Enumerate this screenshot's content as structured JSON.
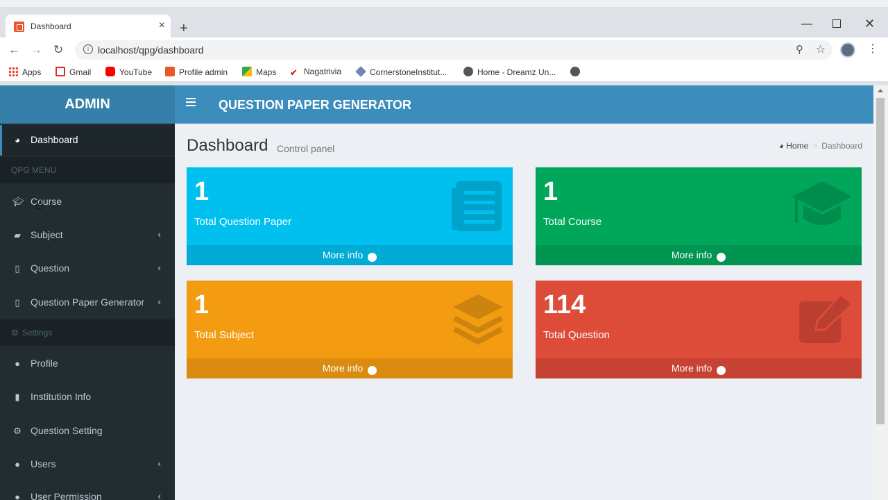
{
  "browser": {
    "tab_title": "Dashboard",
    "url": "localhost/qpg/dashboard",
    "bookmarks": [
      "Apps",
      "Gmail",
      "YouTube",
      "Profile admin",
      "Maps",
      "Nagatrivia",
      "CornerstoneInstitut...",
      "Home - Dreamz Un..."
    ]
  },
  "sidebar": {
    "logo": "ADMIN",
    "dashboard": "Dashboard",
    "section_qpg": "QPG MENU",
    "course": "Course",
    "subject": "Subject",
    "question": "Question",
    "qpg": "Question Paper Generator",
    "section_settings": "Settings",
    "profile": "Profile",
    "institution": "Institution Info",
    "question_setting": "Question Setting",
    "users": "Users",
    "user_permission": "User Permission"
  },
  "header": {
    "title": "QUESTION PAPER GENERATOR"
  },
  "content": {
    "title": "Dashboard",
    "subtitle": "Control panel",
    "breadcrumb_home": "Home",
    "breadcrumb_current": "Dashboard"
  },
  "boxes": [
    {
      "count": "1",
      "label": "Total Question Paper",
      "more": "More info",
      "color": "#00c0ef",
      "icon": "newspaper-icon"
    },
    {
      "count": "1",
      "label": "Total Course",
      "more": "More info",
      "color": "#00a65a",
      "icon": "graduation-cap-icon"
    },
    {
      "count": "1",
      "label": "Total Subject",
      "more": "More info",
      "color": "#f39c12",
      "icon": "layers-icon"
    },
    {
      "count": "114",
      "label": "Total Question",
      "more": "More info",
      "color": "#dd4b39",
      "icon": "edit-icon"
    }
  ]
}
